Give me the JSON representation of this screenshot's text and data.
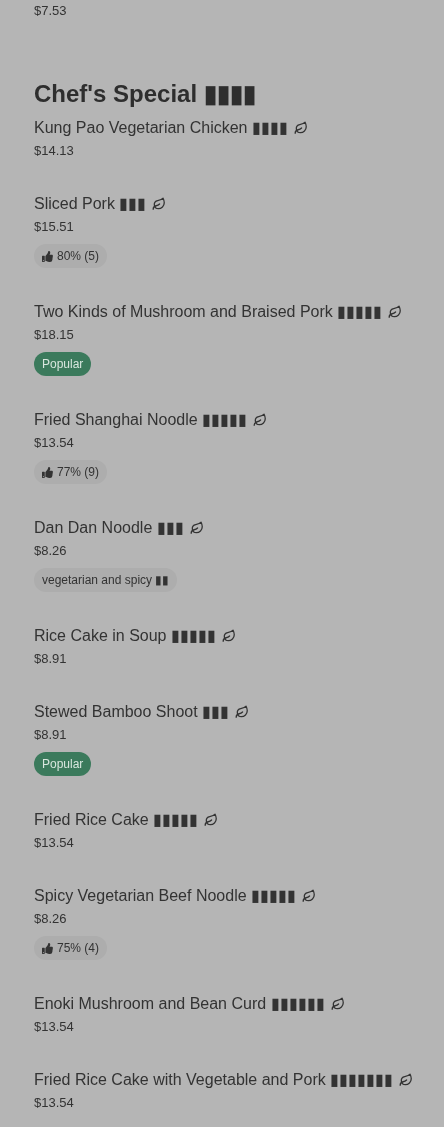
{
  "previous_item": {
    "price": "$7.53"
  },
  "section": {
    "title": "Chef's Special ▮▮▮▮",
    "items": [
      {
        "name": "Kung Pao Vegetarian Chicken ▮▮▮▮",
        "price": "$14.13"
      },
      {
        "name": "Sliced Pork ▮▮▮",
        "price": "$15.51",
        "badge": {
          "kind": "rating",
          "text": "80% (5)"
        }
      },
      {
        "name": "Two Kinds of Mushroom and Braised Pork ▮▮▮▮▮",
        "price": "$18.15",
        "badge": {
          "kind": "popular",
          "text": "Popular"
        }
      },
      {
        "name": "Fried Shanghai Noodle ▮▮▮▮▮",
        "price": "$13.54",
        "badge": {
          "kind": "rating",
          "text": "77% (9)"
        }
      },
      {
        "name": "Dan Dan Noodle ▮▮▮",
        "price": "$8.26",
        "badge": {
          "kind": "tag",
          "text": "vegetarian and spicy ▮▮"
        }
      },
      {
        "name": "Rice Cake in Soup ▮▮▮▮▮",
        "price": "$8.91"
      },
      {
        "name": "Stewed Bamboo Shoot ▮▮▮",
        "price": "$8.91",
        "badge": {
          "kind": "popular",
          "text": "Popular"
        }
      },
      {
        "name": "Fried Rice Cake ▮▮▮▮▮",
        "price": "$13.54"
      },
      {
        "name": "Spicy Vegetarian Beef Noodle ▮▮▮▮▮",
        "price": "$8.26",
        "badge": {
          "kind": "rating",
          "text": "75% (4)"
        }
      },
      {
        "name": "Enoki Mushroom and Bean Curd ▮▮▮▮▮▮",
        "price": "$13.54"
      },
      {
        "name": "Fried Rice Cake with Vegetable and Pork ▮▮▮▮▮▮▮",
        "price": "$13.54"
      }
    ]
  }
}
